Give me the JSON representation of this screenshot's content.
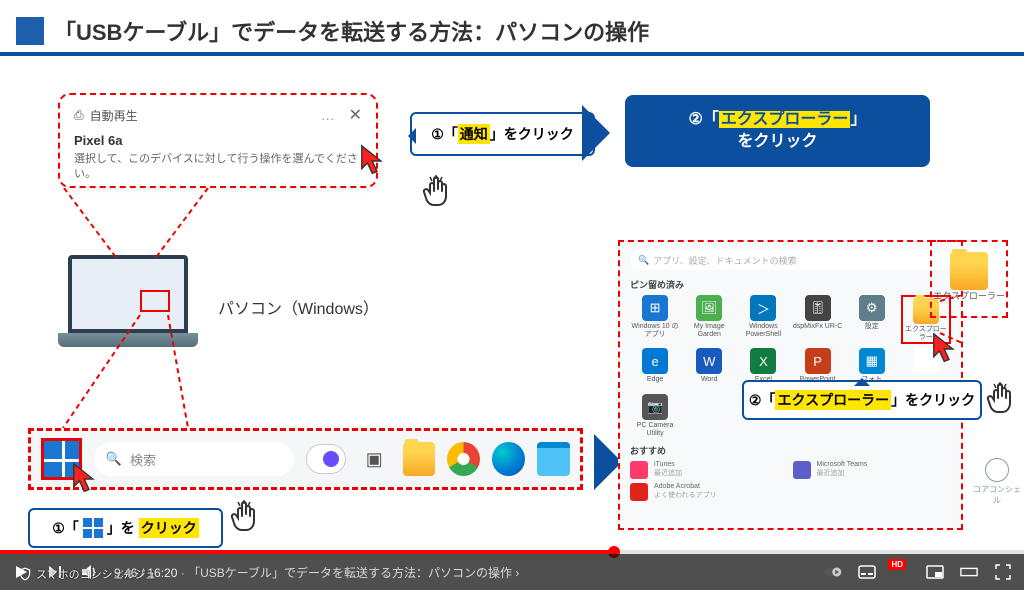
{
  "title": "「USBケーブル」でデータを転送する方法：パソコンの操作",
  "notification": {
    "autoplay": "自動再生",
    "device": "Pixel 6a",
    "body": "選択して、このデバイスに対して行う操作を選んでください。",
    "more": "…"
  },
  "step1": {
    "prefix": "①「",
    "target": "通知",
    "suffix": "」を",
    "action": "クリック"
  },
  "step2_main": {
    "prefix": "②「",
    "target": "エクスプローラー",
    "suffix_line1": "」",
    "line2_prefix": "を",
    "action": "クリック"
  },
  "step2_sub": {
    "prefix": "②「",
    "target": "エクスプローラー",
    "suffix": "」を",
    "action": "クリック"
  },
  "step_start": {
    "prefix": "①「",
    "suffix": "」を",
    "action": "クリック"
  },
  "laptop_label": "パソコン（Windows）",
  "taskbar": {
    "search_placeholder": "検索",
    "items": [
      "widgets",
      "chat",
      "explorer",
      "chrome",
      "edge",
      "notepad"
    ]
  },
  "startmenu": {
    "search_placeholder": "アプリ、設定、ドキュメントの検索",
    "pinned_label": "ピン留め済み",
    "reco_label": "おすすめ",
    "items": [
      {
        "label": "Windows 10 のアプリ",
        "color": "#1976d2",
        "glyph": "⊞"
      },
      {
        "label": "My Image Garden",
        "color": "#4caf50",
        "glyph": "🖼"
      },
      {
        "label": "Windows PowerShell",
        "color": "#0277bd",
        "glyph": "＞"
      },
      {
        "label": "dspMixFx UR-C",
        "color": "#444",
        "glyph": "🎚"
      },
      {
        "label": "設定",
        "color": "#607d8b",
        "glyph": "⚙"
      },
      {
        "label": "エクスプローラー",
        "color": "folder",
        "glyph": ""
      },
      {
        "label": "Edge",
        "color": "#0078d4",
        "glyph": "e"
      },
      {
        "label": "Word",
        "color": "#185abd",
        "glyph": "W"
      },
      {
        "label": "Excel",
        "color": "#107c41",
        "glyph": "X"
      },
      {
        "label": "PowerPoint",
        "color": "#c43e1c",
        "glyph": "P"
      },
      {
        "label": "フォト",
        "color": "#0288d1",
        "glyph": "▦"
      },
      {
        "label": "",
        "color": "#fff",
        "glyph": ""
      },
      {
        "label": "PC Camera Utility",
        "color": "#555",
        "glyph": "📷"
      }
    ],
    "reco": [
      {
        "label": "iTunes",
        "sub": "最近追加",
        "color": "#ff3b6b"
      },
      {
        "label": "Microsoft Teams",
        "sub": "最近追加",
        "color": "#5b5fc7"
      },
      {
        "label": "Adobe Acrobat",
        "sub": "よく使われるアプリ",
        "color": "#e2231a"
      }
    ]
  },
  "explorer_callout_label": "エクスプローラー",
  "video": {
    "current": "9:46",
    "total": "16:20",
    "chapter": "「USBケーブル」でデータを転送する方法：パソコンの操作",
    "channel": "スマホのコンシェルジュ"
  },
  "watermark": "コアコンシェル"
}
